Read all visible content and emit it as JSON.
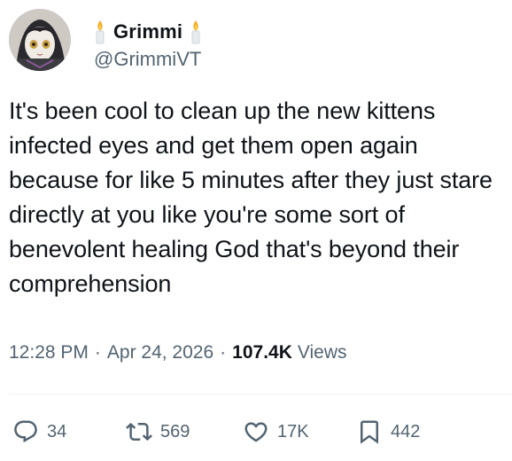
{
  "author": {
    "display_name": "Grimmi",
    "handle": "@GrimmiVT",
    "avatar_icon": "avatar-anime-portrait",
    "name_emoji_icon": "candle-icon"
  },
  "tweet": {
    "text": "It's been cool to clean up the new kittens infected eyes and get them open again because for like 5 minutes after they just stare directly at you like you're some sort of benevolent healing God that's beyond their comprehension"
  },
  "meta": {
    "time": "12:28 PM",
    "dot1": "·",
    "date": "Apr 24, 2026",
    "dot2": "·",
    "views_count": "107.4K",
    "views_label": "Views"
  },
  "actions": {
    "replies": "34",
    "retweets": "569",
    "likes": "17K",
    "bookmarks": "442"
  },
  "colors": {
    "text": "#0f1419",
    "secondary": "#536471",
    "divider": "#eff3f4"
  }
}
